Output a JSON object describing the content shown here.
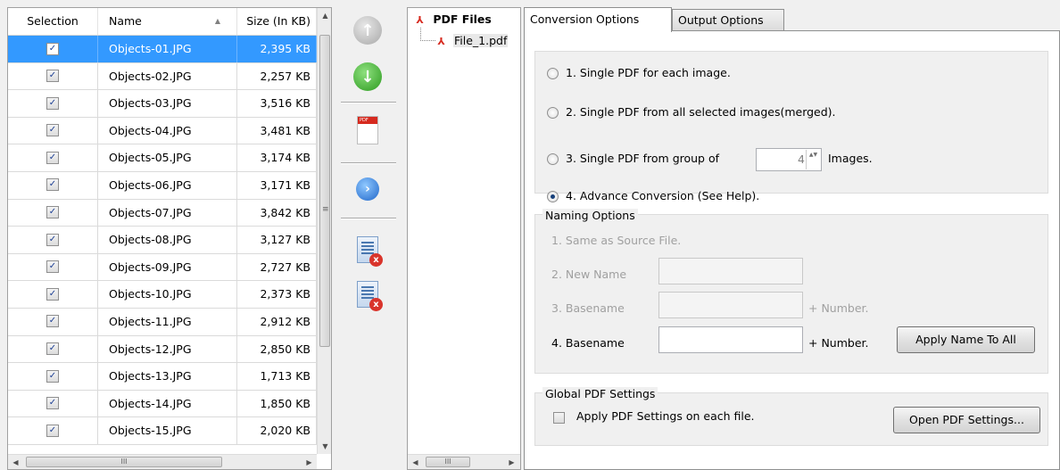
{
  "grid": {
    "columns": {
      "selection": "Selection",
      "name": "Name",
      "size": "Size (In KB)"
    },
    "sort_arrow": "▲",
    "rows": [
      {
        "checked": true,
        "name": "Objects-01.JPG",
        "size": "2,395 KB"
      },
      {
        "checked": true,
        "name": "Objects-02.JPG",
        "size": "2,257 KB"
      },
      {
        "checked": true,
        "name": "Objects-03.JPG",
        "size": "3,516 KB"
      },
      {
        "checked": true,
        "name": "Objects-04.JPG",
        "size": "3,481 KB"
      },
      {
        "checked": true,
        "name": "Objects-05.JPG",
        "size": "3,174 KB"
      },
      {
        "checked": true,
        "name": "Objects-06.JPG",
        "size": "3,171 KB"
      },
      {
        "checked": true,
        "name": "Objects-07.JPG",
        "size": "3,842 KB"
      },
      {
        "checked": true,
        "name": "Objects-08.JPG",
        "size": "3,127 KB"
      },
      {
        "checked": true,
        "name": "Objects-09.JPG",
        "size": "2,727 KB"
      },
      {
        "checked": true,
        "name": "Objects-10.JPG",
        "size": "2,373 KB"
      },
      {
        "checked": true,
        "name": "Objects-11.JPG",
        "size": "2,912 KB"
      },
      {
        "checked": true,
        "name": "Objects-12.JPG",
        "size": "2,850 KB"
      },
      {
        "checked": true,
        "name": "Objects-13.JPG",
        "size": "1,713 KB"
      },
      {
        "checked": true,
        "name": "Objects-14.JPG",
        "size": "1,850 KB"
      },
      {
        "checked": true,
        "name": "Objects-15.JPG",
        "size": "2,020 KB"
      }
    ],
    "selected_row": 0,
    "check_glyph": "✓",
    "scroll_grip": "≡",
    "hscroll_grip": "III"
  },
  "toolbar": {
    "move_up_icon": "↑",
    "move_down_icon": "↓",
    "pdf_band_label": "PDF",
    "next_icon": "›",
    "remove_glyph": "x"
  },
  "tree": {
    "root_label": "PDF Files",
    "child_label": "File_1.pdf",
    "pdf_glyph": "⅄",
    "hscroll_grip": "III"
  },
  "tabs": {
    "conversion": "Conversion Options",
    "output": "Output Options"
  },
  "conversion": {
    "option1": "1. Single PDF for each image.",
    "option2": "2. Single PDF from all selected images(merged).",
    "option3": "3. Single PDF from group of",
    "group_count": "4",
    "images_label": "Images.",
    "option4": "4. Advance Conversion (See Help).",
    "selected_option": 4,
    "spin_glyph": "▲▼"
  },
  "naming": {
    "title": "Naming Options",
    "opt1": "1. Same as Source File.",
    "opt2": "2. New Name",
    "opt3": "3. Basename",
    "opt3_suffix": "+ Number.",
    "opt4": "4. Basename",
    "opt4_suffix": "+ Number.",
    "opt4_value": "",
    "apply_button": "Apply Name To All"
  },
  "global": {
    "title": "Global PDF Settings",
    "checkbox_label": "Apply PDF Settings on each file.",
    "checked": false,
    "open_button": "Open PDF Settings..."
  },
  "colors": {
    "selection": "#3399ff",
    "pdf_red": "#d62a1f",
    "radio_dot": "#17407a"
  }
}
